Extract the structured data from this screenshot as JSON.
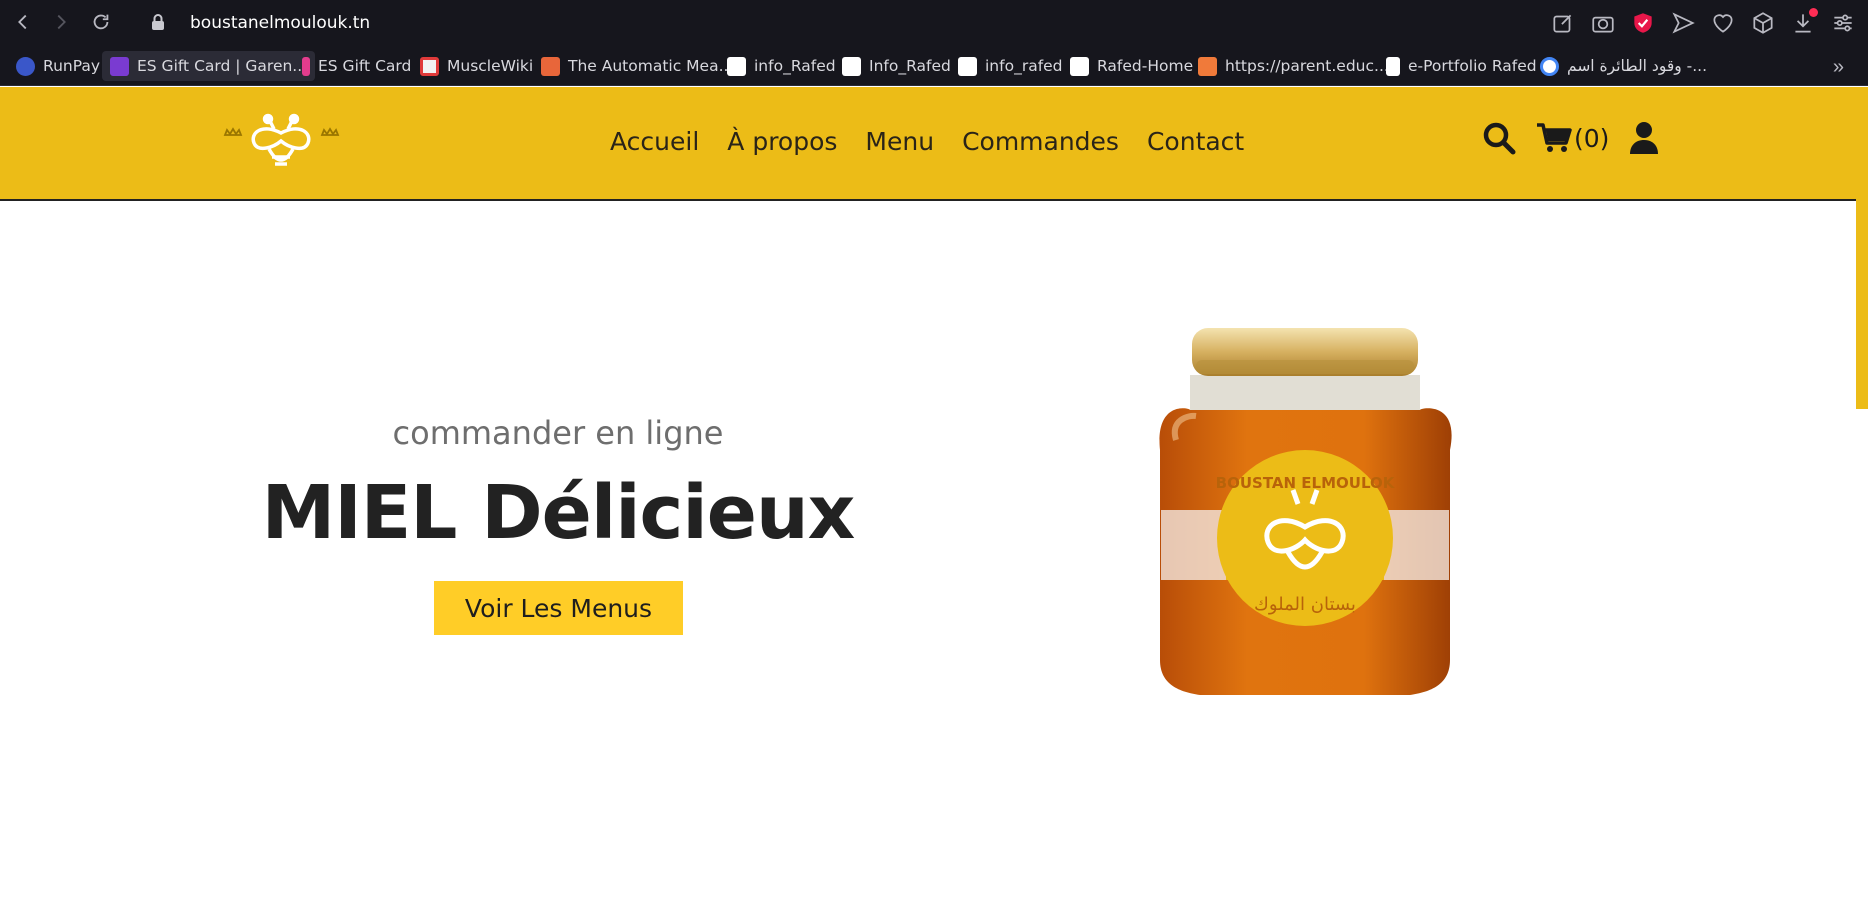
{
  "browser": {
    "url": "boustanelmoulouk.tn",
    "bookmarks": [
      {
        "label": "RunPay",
        "color": "#3a57c9"
      },
      {
        "label": "ES Gift Card | Garen...",
        "color": "#7a3bd1"
      },
      {
        "label": "ES Gift Card",
        "color": "#e33c8d"
      },
      {
        "label": "MuscleWiki",
        "color": "#e03a3a"
      },
      {
        "label": "The Automatic Mea...",
        "color": "#e8663a"
      },
      {
        "label": "info_Rafed",
        "color": "#ffffff"
      },
      {
        "label": "Info_Rafed",
        "color": "#ffffff"
      },
      {
        "label": "info_rafed",
        "color": "#ffffff"
      },
      {
        "label": "Rafed-Home",
        "color": "#ffffff"
      },
      {
        "label": "https://parent.educ...",
        "color": "#f07a3a"
      },
      {
        "label": "e-Portfolio Rafed",
        "color": "#ffffff"
      },
      {
        "label": "وقود الطائرة اسم -...",
        "color": "#4285f4"
      }
    ],
    "more": "»"
  },
  "header": {
    "nav": [
      "Accueil",
      "À propos",
      "Menu",
      "Commandes",
      "Contact"
    ],
    "cart_count": "(0)",
    "accent": "#ecbc17"
  },
  "hero": {
    "subtitle": "commander en ligne",
    "title": "MIEL Délicieux",
    "cta": "Voir Les Menus",
    "cta_color": "#ffcd27"
  },
  "jar": {
    "label_top": "BOUSTAN ELMOULOK",
    "label_bottom": "بستان الملوك"
  }
}
